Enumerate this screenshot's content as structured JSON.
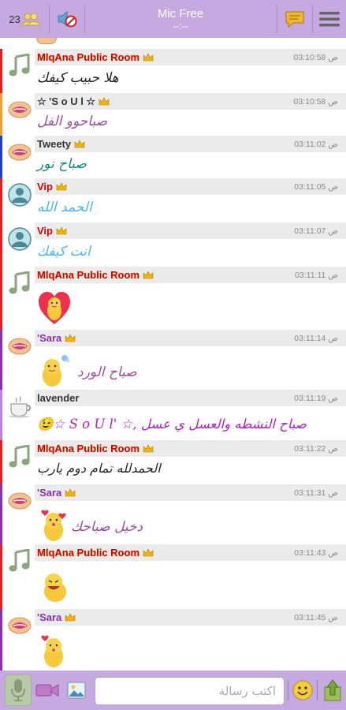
{
  "topbar": {
    "user_count": "23",
    "title": "Mic Free",
    "subtitle": "--:--"
  },
  "colors": {
    "header_bg": "#c6a9e0",
    "row_header_bg": "#ebebeb",
    "name_red": "#d90000",
    "name_purple": "#8b2fb7",
    "name_dark": "#333333",
    "crown": "#f2b600"
  },
  "messages": [
    {
      "name": "MlqAna Public Room",
      "name_color": "#d90000",
      "name_style": "owner",
      "time": "03:10:58 ص",
      "text": "هلا حبيب كيفك",
      "text_color": "#222222",
      "avatar": "music-avatar",
      "bar_color": "#e02020"
    },
    {
      "name": "☆ 'S o U l ☆",
      "name_color": "#333333",
      "name_style": "plain",
      "time": "03:10:58 ص",
      "text": "صباحوو الفل",
      "text_color": "#a04aa4",
      "avatar": "lips-avatar",
      "bar_color": "#f0a030"
    },
    {
      "name": "Tweety",
      "name_color": "#333333",
      "name_style": "plain",
      "time": "03:11:02 ص",
      "text": "صباح نور",
      "text_color": "#1a8a78",
      "avatar": "lips-avatar",
      "bar_color": "#2040c0"
    },
    {
      "name": "Vip",
      "name_color": "#d90000",
      "name_style": "plain",
      "time": "03:11:05 ص",
      "text": "الحمد الله",
      "text_color": "#4ab8e8",
      "avatar": "user-avatar",
      "bar_color": "#e02020"
    },
    {
      "name": "Vip",
      "name_color": "#d90000",
      "name_style": "plain",
      "time": "03:11:07 ص",
      "text": "انت كيفك",
      "text_color": "#4ab8e8",
      "avatar": "user-avatar",
      "bar_color": "#e02020"
    },
    {
      "name": "MlqAna Public Room",
      "name_color": "#d90000",
      "name_style": "owner",
      "time": "03:11:11 ص",
      "text": "",
      "text_color": "#222222",
      "avatar": "music-avatar",
      "bar_color": "#e02020",
      "sticker": "heart"
    },
    {
      "name": "'Sara",
      "name_color": "#8b2fb7",
      "name_style": "plain",
      "time": "03:11:14 ص",
      "text": "صباح الورد",
      "text_color": "#a04aa4",
      "avatar": "lips-avatar",
      "bar_color": "#8b2fb7",
      "sticker": "flower"
    },
    {
      "name": "lavender",
      "name_color": "#333333",
      "name_style": "plain",
      "time": "03:11:19 ص",
      "text": "صباح النشطه والعسل ي عسل ,☆ 'S o U l ☆😉",
      "text_color": "#b020c8",
      "avatar": "cup-avatar",
      "bar_color": "#c080e0"
    },
    {
      "name": "MlqAna Public Room",
      "name_color": "#d90000",
      "name_style": "owner",
      "time": "03:11:22 ص",
      "text": "الحمدلله تمام دوم يارب",
      "text_color": "#222222",
      "avatar": "music-avatar",
      "bar_color": "#e02020"
    },
    {
      "name": "'Sara",
      "name_color": "#8b2fb7",
      "name_style": "plain",
      "time": "03:11:31 ص",
      "text": "دخيل صباحك",
      "text_color": "#a04aa4",
      "avatar": "lips-avatar",
      "bar_color": "#8b2fb7",
      "sticker": "kiss"
    },
    {
      "name": "MlqAna Public Room",
      "name_color": "#d90000",
      "name_style": "owner",
      "time": "03:11:43 ص",
      "text": "",
      "text_color": "#222222",
      "avatar": "music-avatar",
      "bar_color": "#e02020",
      "sticker": "laugh"
    },
    {
      "name": "'Sara",
      "name_color": "#8b2fb7",
      "name_style": "plain",
      "time": "03:11:45 ص",
      "text": "",
      "text_color": "#a04aa4",
      "avatar": "lips-avatar",
      "bar_color": "#8b2fb7",
      "sticker": "kiss2"
    }
  ],
  "composer": {
    "placeholder": "اكتب رسالة"
  }
}
